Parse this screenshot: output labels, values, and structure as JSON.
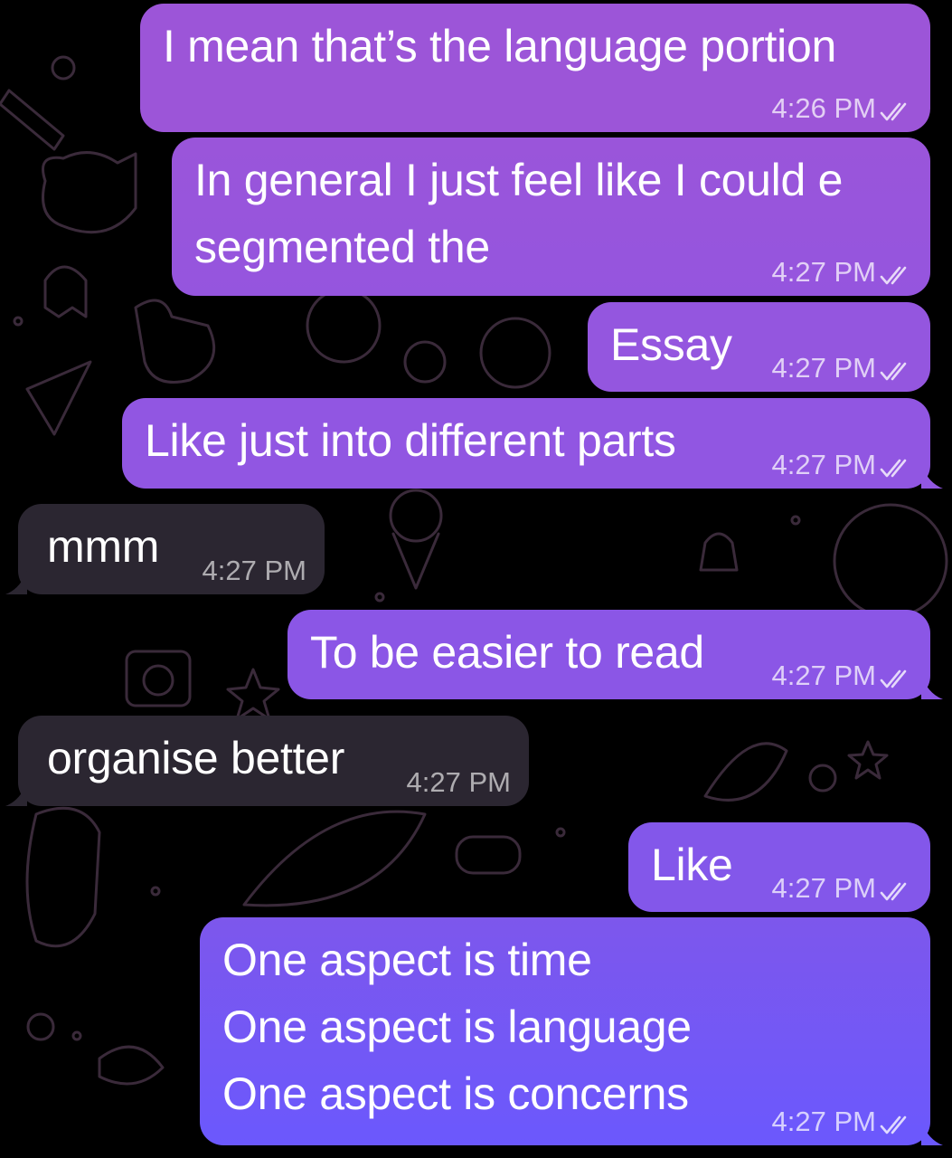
{
  "colors": {
    "background": "#000000",
    "outgoing_gradient_top": "#9d55d7",
    "outgoing_gradient_bottom": "#6f57fb",
    "incoming_bubble": "#2b2631",
    "doodle_stroke": "#3a2a3a"
  },
  "icons": {
    "read_receipt": "double-check-icon"
  },
  "messages": [
    {
      "text": "I mean that’s the language portion",
      "time": "4:26 PM",
      "direction": "outgoing",
      "read": true
    },
    {
      "text": "In general I just feel like I could e\nsegmented the",
      "time": "4:27 PM",
      "direction": "outgoing",
      "read": true
    },
    {
      "text": "Essay",
      "time": "4:27 PM",
      "direction": "outgoing",
      "read": true
    },
    {
      "text": "Like just into different parts",
      "time": "4:27 PM",
      "direction": "outgoing",
      "read": true
    },
    {
      "text": "mmm",
      "time": "4:27 PM",
      "direction": "incoming"
    },
    {
      "text": "To be easier to read",
      "time": "4:27 PM",
      "direction": "outgoing",
      "read": true
    },
    {
      "text": "organise better",
      "time": "4:27 PM",
      "direction": "incoming"
    },
    {
      "text": "Like",
      "time": "4:27 PM",
      "direction": "outgoing",
      "read": true
    },
    {
      "text": "One aspect is time\nOne aspect is language\nOne aspect is concerns",
      "time": "4:27 PM",
      "direction": "outgoing",
      "read": true
    }
  ]
}
